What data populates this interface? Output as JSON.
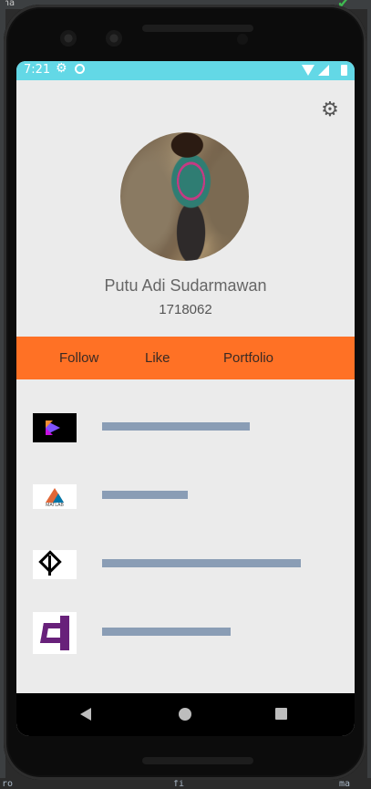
{
  "status_bar": {
    "time": "7:21",
    "icons": [
      "gear-icon",
      "sync-icon",
      "wifi-icon",
      "signal-icon",
      "battery-icon"
    ]
  },
  "desktop": {
    "top_label": "na",
    "bottom_left": "ro",
    "bottom_mid": "fi",
    "bottom_right": "ma"
  },
  "settings": {
    "icon": "gear-icon",
    "glyph": "⚙"
  },
  "profile": {
    "name": "Putu Adi Sudarmawan",
    "id": "1718062"
  },
  "actions": {
    "follow": "Follow",
    "like": "Like",
    "portfolio": "Portfolio"
  },
  "skills": [
    {
      "name": "kotlin-logo",
      "level": 0.55,
      "logo_text": ""
    },
    {
      "name": "matlab-logo",
      "level": 0.32,
      "logo_text": "MATLAB"
    },
    {
      "name": "unity-logo",
      "level": 0.74,
      "logo_text": ""
    },
    {
      "name": "visual-studio-logo",
      "level": 0.48,
      "logo_text": ""
    }
  ],
  "colors": {
    "status_bar": "#63d8e6",
    "action_bar": "#ff7125",
    "skill_bar": "#8a9db5",
    "background": "#ebebeb"
  }
}
